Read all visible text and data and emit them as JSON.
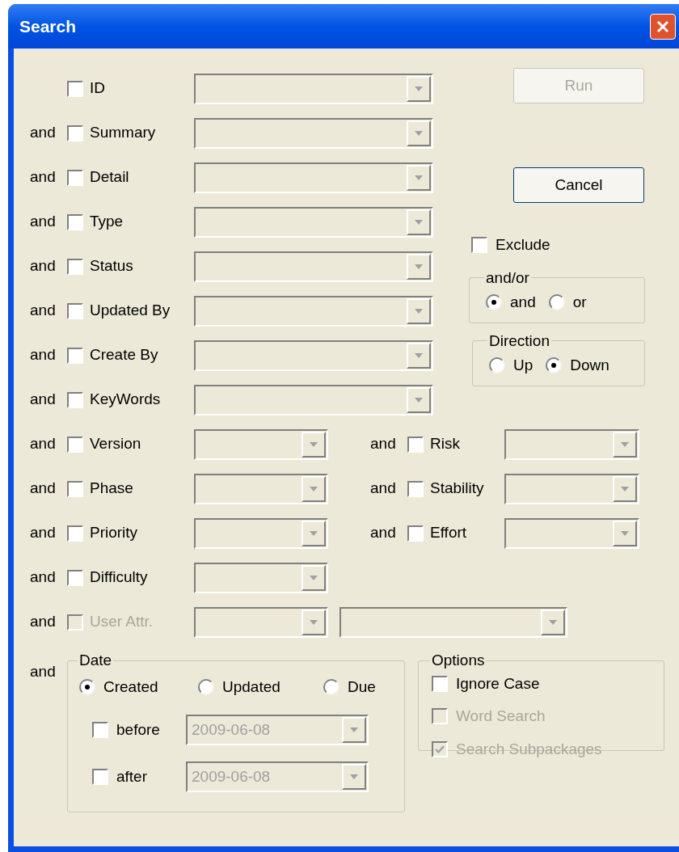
{
  "window": {
    "title": "Search"
  },
  "criteria": [
    {
      "label": "ID",
      "checked": false
    },
    {
      "conjunction": "and",
      "label": "Summary",
      "checked": false
    },
    {
      "conjunction": "and",
      "label": "Detail",
      "checked": false
    },
    {
      "conjunction": "and",
      "label": "Type",
      "checked": false
    },
    {
      "conjunction": "and",
      "label": "Status",
      "checked": false
    },
    {
      "conjunction": "and",
      "label": "Updated By",
      "checked": false
    },
    {
      "conjunction": "and",
      "label": "Create By",
      "checked": false
    },
    {
      "conjunction": "and",
      "label": "KeyWords",
      "checked": false
    }
  ],
  "paired_criteria": [
    {
      "left": {
        "conjunction": "and",
        "label": "Version",
        "checked": false
      },
      "right": {
        "conjunction": "and",
        "label": "Risk",
        "checked": false
      }
    },
    {
      "left": {
        "conjunction": "and",
        "label": "Phase",
        "checked": false
      },
      "right": {
        "conjunction": "and",
        "label": "Stability",
        "checked": false
      }
    },
    {
      "left": {
        "conjunction": "and",
        "label": "Priority",
        "checked": false
      },
      "right": {
        "conjunction": "and",
        "label": "Effort",
        "checked": false
      }
    },
    {
      "left": {
        "conjunction": "and",
        "label": "Difficulty",
        "checked": false
      }
    }
  ],
  "user_attribute": {
    "conjunction": "and",
    "label": "User Attr.",
    "checked": false,
    "disabled": true
  },
  "buttons": [
    {
      "label": "Run",
      "disabled": true
    },
    {
      "label": "Cancel",
      "disabled": false
    }
  ],
  "exclude": {
    "label": "Exclude",
    "checked": false
  },
  "and_or": {
    "title": "and/or",
    "options": [
      {
        "label": "and",
        "selected": true
      },
      {
        "label": "or",
        "selected": false
      }
    ]
  },
  "direction": {
    "title": "Direction",
    "options": [
      {
        "label": "Up",
        "selected": false
      },
      {
        "label": "Down",
        "selected": true
      }
    ]
  },
  "date": {
    "conjunction": "and",
    "title": "Date",
    "options": [
      {
        "label": "Created",
        "selected": true
      },
      {
        "label": "Updated",
        "selected": false
      },
      {
        "label": "Due",
        "selected": false
      }
    ],
    "bounds": [
      {
        "label": "before",
        "checked": false,
        "value": "2009-06-08"
      },
      {
        "label": "after",
        "checked": false,
        "value": "2009-06-08"
      }
    ]
  },
  "options": {
    "title": "Options",
    "items": [
      {
        "label": "Ignore Case",
        "checked": false,
        "disabled": false
      },
      {
        "label": "Word Search",
        "checked": false,
        "disabled": true
      },
      {
        "label": "Search Subpackages",
        "checked": true,
        "disabled": true
      }
    ]
  }
}
